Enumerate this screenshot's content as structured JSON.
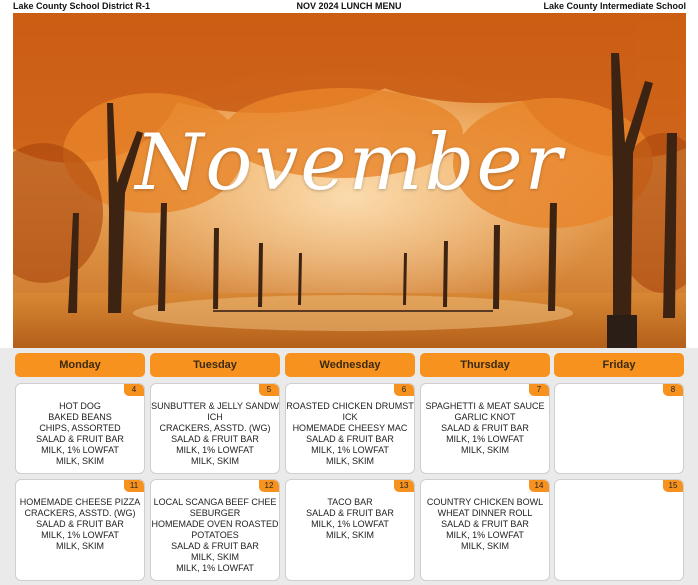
{
  "header": {
    "left": "Lake County School District R-1",
    "center": "NOV 2024 LUNCH MENU",
    "right": "Lake County Intermediate School"
  },
  "banner": {
    "title": "November"
  },
  "days": [
    "Monday",
    "Tuesday",
    "Wednesday",
    "Thursday",
    "Friday"
  ],
  "weeks": [
    [
      {
        "date": "4",
        "items": [
          "HOT DOG",
          "BAKED BEANS",
          "CHIPS, ASSORTED",
          "SALAD & FRUIT BAR",
          "MILK, 1% LOWFAT",
          "MILK, SKIM"
        ]
      },
      {
        "date": "5",
        "items": [
          "SUNBUTTER & JELLY SANDWICH",
          "CRACKERS, ASSTD. (WG)",
          "SALAD & FRUIT BAR",
          "MILK, 1% LOWFAT",
          "MILK, SKIM"
        ]
      },
      {
        "date": "6",
        "items": [
          "ROASTED CHICKEN DRUMSTICK",
          "HOMEMADE CHEESY MAC",
          "SALAD & FRUIT BAR",
          "MILK, 1% LOWFAT",
          "MILK, SKIM"
        ]
      },
      {
        "date": "7",
        "items": [
          "SPAGHETTI & MEAT SAUCE",
          "GARLIC KNOT",
          "SALAD & FRUIT BAR",
          "MILK, 1% LOWFAT",
          "MILK, SKIM"
        ]
      },
      {
        "date": "8",
        "items": []
      }
    ],
    [
      {
        "date": "11",
        "items": [
          "HOMEMADE CHEESE PIZZA",
          "CRACKERS, ASSTD. (WG)",
          "SALAD & FRUIT BAR",
          "MILK, 1% LOWFAT",
          "MILK, SKIM"
        ]
      },
      {
        "date": "12",
        "items": [
          "LOCAL SCANGA BEEF CHEESEBURGER",
          "HOMEMADE OVEN ROASTED POTATOES",
          "SALAD & FRUIT BAR",
          "MILK, SKIM",
          "MILK, 1% LOWFAT"
        ]
      },
      {
        "date": "13",
        "items": [
          "TACO BAR",
          "SALAD & FRUIT BAR",
          "MILK, 1% LOWFAT",
          "MILK, SKIM"
        ]
      },
      {
        "date": "14",
        "items": [
          "COUNTRY CHICKEN BOWL",
          "WHEAT DINNER ROLL",
          "SALAD & FRUIT BAR",
          "MILK, 1% LOWFAT",
          "MILK, SKIM"
        ]
      },
      {
        "date": "15",
        "items": []
      }
    ]
  ],
  "colors": {
    "accent": "#f7921e",
    "background": "#eaeaea"
  }
}
